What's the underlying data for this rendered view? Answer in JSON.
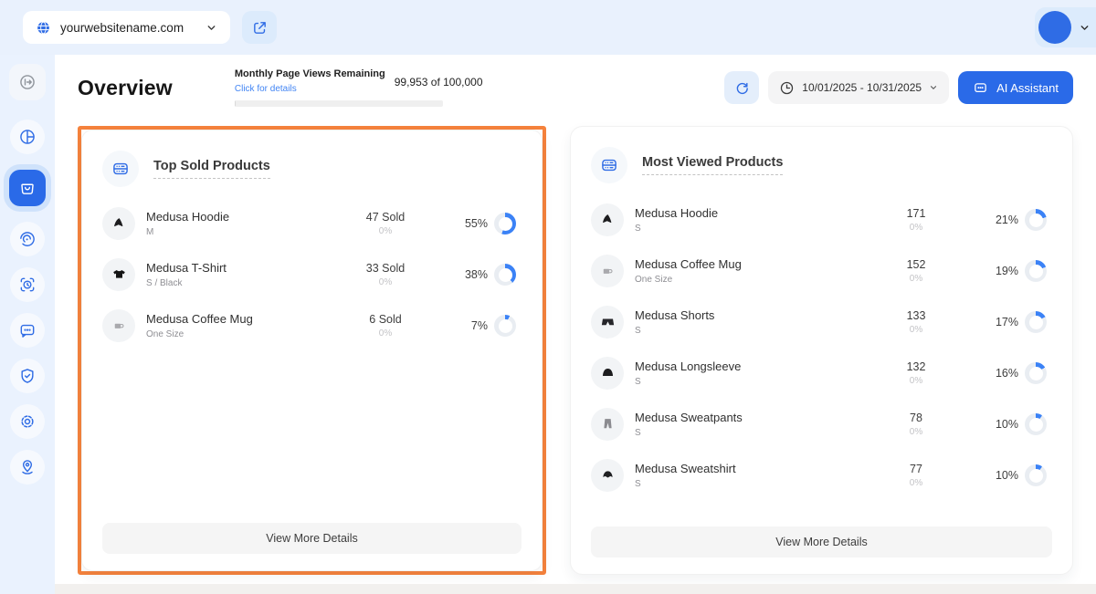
{
  "colors": {
    "accent": "#2f6ce5",
    "donut_fill": "#3b82f6",
    "donut_track": "#e9edf2",
    "highlight": "#f5823c"
  },
  "topbar": {
    "domain": "yourwebsitename.com"
  },
  "sidebar": {
    "items": [
      "sidebar-toggle",
      "analytics",
      "products",
      "sessions",
      "activity",
      "chat",
      "security",
      "settings",
      "locations"
    ]
  },
  "header": {
    "title": "Overview",
    "page_views": {
      "label": "Monthly Page Views Remaining",
      "link": "Click for details",
      "value": "99,953 of 100,000"
    },
    "date_range": "10/01/2025 - 10/31/2025",
    "ai_assistant_label": "AI Assistant"
  },
  "cards": {
    "top_sold": {
      "title": "Top Sold Products",
      "footer_label": "View More Details",
      "products": [
        {
          "name": "Medusa Hoodie",
          "variant": "M",
          "count": "47 Sold",
          "count_sub": "0%",
          "share": "55%",
          "icon": "hoodie"
        },
        {
          "name": "Medusa T-Shirt",
          "variant": "S / Black",
          "count": "33 Sold",
          "count_sub": "0%",
          "share": "38%",
          "icon": "tshirt"
        },
        {
          "name": "Medusa Coffee Mug",
          "variant": "One Size",
          "count": "6 Sold",
          "count_sub": "0%",
          "share": "7%",
          "icon": "mug"
        }
      ]
    },
    "most_viewed": {
      "title": "Most Viewed Products",
      "footer_label": "View More Details",
      "products": [
        {
          "name": "Medusa Hoodie",
          "variant": "S",
          "count": "171",
          "count_sub": "0%",
          "share": "21%",
          "icon": "hoodie"
        },
        {
          "name": "Medusa Coffee Mug",
          "variant": "One Size",
          "count": "152",
          "count_sub": "0%",
          "share": "19%",
          "icon": "mug"
        },
        {
          "name": "Medusa Shorts",
          "variant": "S",
          "count": "133",
          "count_sub": "0%",
          "share": "17%",
          "icon": "shorts"
        },
        {
          "name": "Medusa Longsleeve",
          "variant": "S",
          "count": "132",
          "count_sub": "0%",
          "share": "16%",
          "icon": "longsleeve"
        },
        {
          "name": "Medusa Sweatpants",
          "variant": "S",
          "count": "78",
          "count_sub": "0%",
          "share": "10%",
          "icon": "sweatpants"
        },
        {
          "name": "Medusa Sweatshirt",
          "variant": "S",
          "count": "77",
          "count_sub": "0%",
          "share": "10%",
          "icon": "sweatshirt"
        }
      ]
    }
  }
}
